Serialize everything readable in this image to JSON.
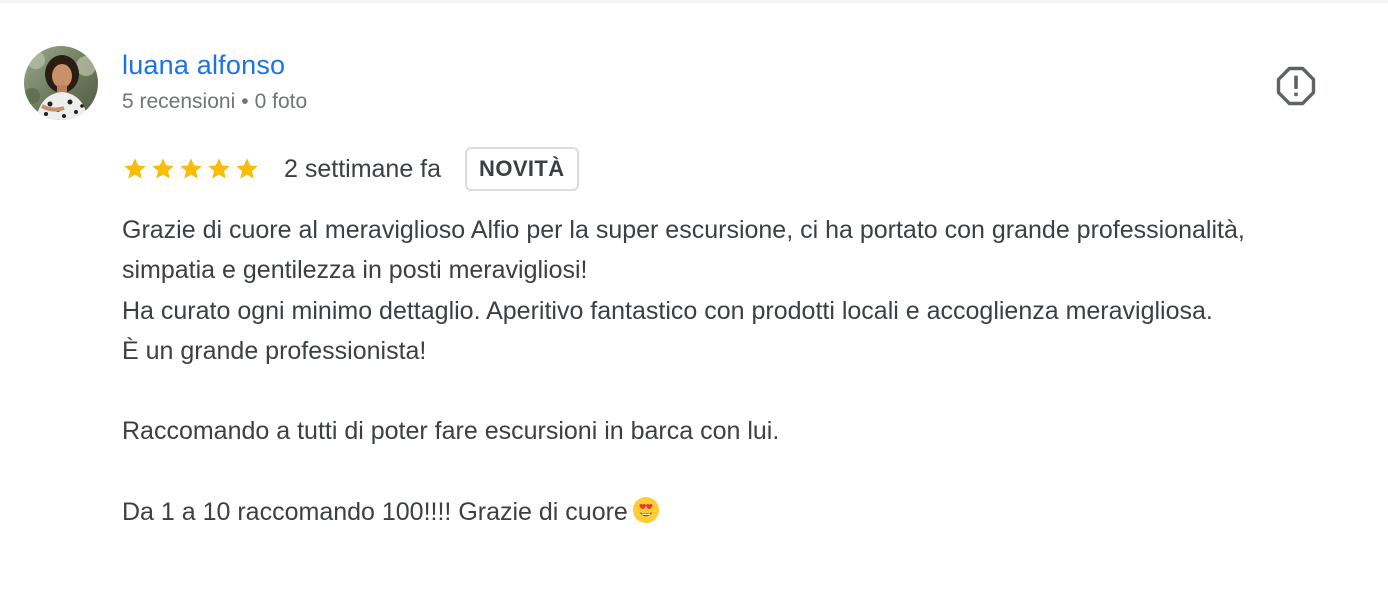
{
  "review": {
    "author": {
      "name": "luana alfonso",
      "reviews_count": "5 recensioni",
      "separator": "•",
      "photos_count": "0 foto"
    },
    "rating": {
      "stars": 5,
      "max_stars": 5,
      "star_color": "#fbbc04"
    },
    "date": "2 settimane fa",
    "badge": "NOVITÀ",
    "text": {
      "line1": "Grazie di cuore al meraviglioso Alfio per la super escursione, ci ha portato con grande professionalità, simpatia e gentilezza in posti meravigliosi!",
      "line2": "Ha curato ogni minimo dettaglio. Aperitivo fantastico con prodotti locali e accoglienza meravigliosa.",
      "line3": "È un grande professionista!",
      "line4": "Raccomando a tutti di poter fare escursioni in barca con lui.",
      "line5": "Da 1 a 10 raccomando 100!!!! Grazie di cuore"
    },
    "emoji_icon": "heart-eyes-emoji-icon",
    "report_icon": "report-icon"
  },
  "colors": {
    "link": "#1a73e8",
    "secondary_text": "#70757a",
    "primary_text": "#3c4043",
    "icon": "#5f6368"
  }
}
